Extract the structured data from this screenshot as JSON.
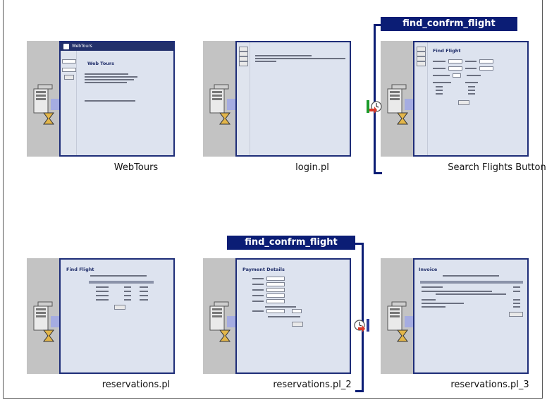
{
  "transactions": [
    {
      "label": "find_confrm_flight"
    },
    {
      "label": "find_confrm_flight"
    }
  ],
  "steps": [
    {
      "caption": "WebTours",
      "thumb_title": "Web Tours",
      "logo_text": "WebTours"
    },
    {
      "caption": "login.pl"
    },
    {
      "caption": "Search Flights Button",
      "thumb_title": "Find Flight"
    },
    {
      "caption": "reservations.pl",
      "thumb_title": "Find Flight"
    },
    {
      "caption": "reservations.pl_2",
      "thumb_title": "Payment Details"
    },
    {
      "caption": "reservations.pl_3",
      "thumb_title": "Invoice"
    }
  ],
  "colors": {
    "transaction": "#0b1d75",
    "thumbnail_bg": "#dde3ef",
    "thumbnail_border": "#1e2d78",
    "gray_bar": "#c3c3c3"
  },
  "icons": [
    "server-hourglass-icon",
    "transaction-start-icon",
    "transaction-end-icon"
  ]
}
